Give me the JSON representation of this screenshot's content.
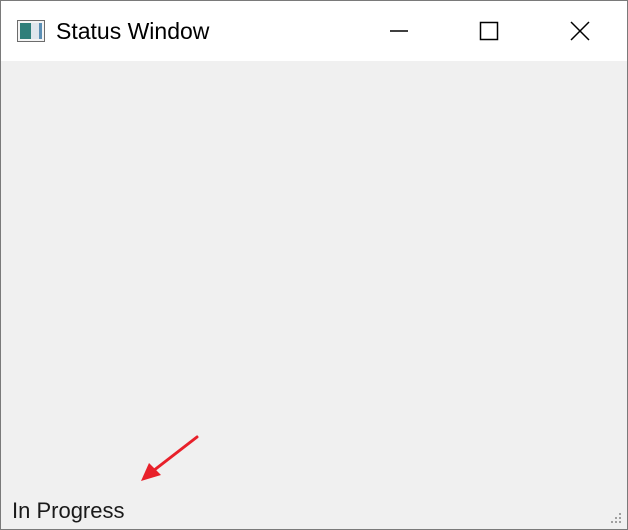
{
  "window": {
    "title": "Status Window",
    "icon": "app-window-icon",
    "controls": {
      "minimize": "minimize-icon",
      "maximize": "maximize-icon",
      "close": "close-icon"
    }
  },
  "status": {
    "text": "In Progress"
  },
  "annotation": {
    "arrow_color": "#e8202a"
  },
  "colors": {
    "titlebar": "#ffffff",
    "client_background": "#f0f0f0",
    "border": "#7a7a7a"
  }
}
